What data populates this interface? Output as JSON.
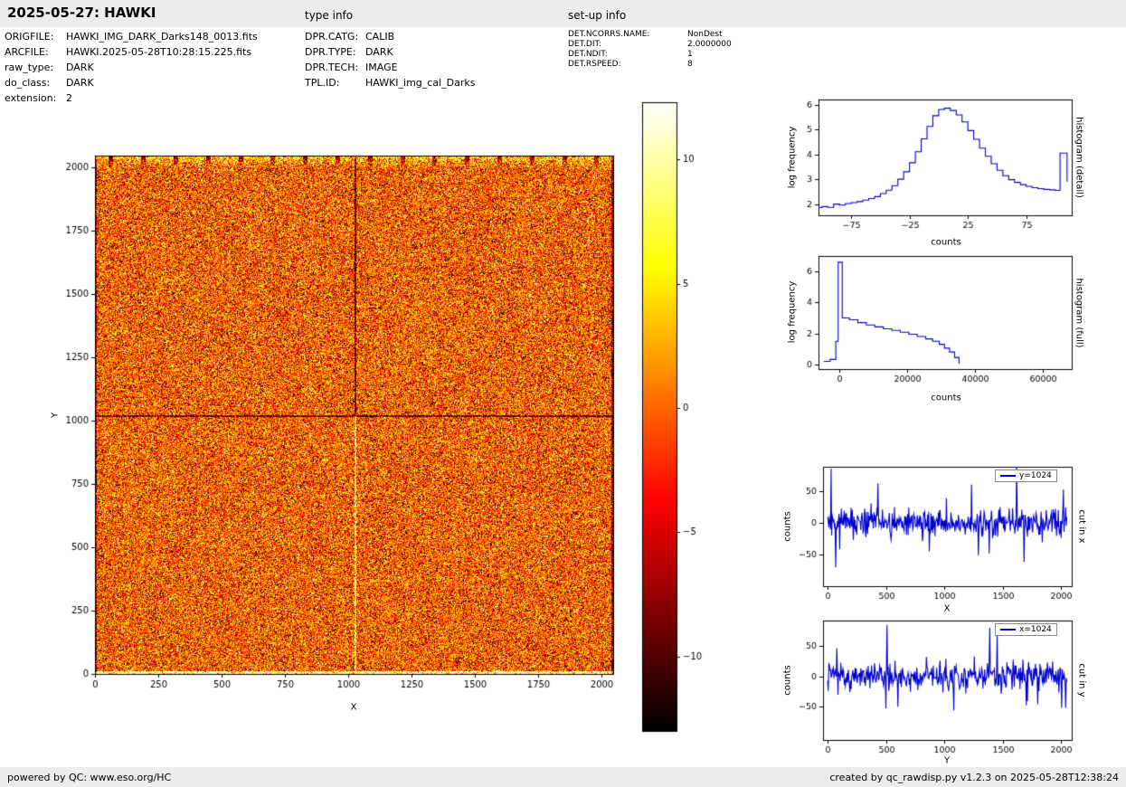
{
  "header": {
    "title": "2025-05-27: HAWKI",
    "type_info_label": "type info",
    "setup_info_label": "set-up info"
  },
  "metadata": {
    "left": [
      {
        "label": "ORIGFILE:",
        "value": "HAWKI_IMG_DARK_Darks148_0013.fits"
      },
      {
        "label": "ARCFILE:",
        "value": "HAWKI.2025-05-28T10:28:15.225.fits"
      },
      {
        "label": "raw_type:",
        "value": "DARK"
      },
      {
        "label": "do_class:",
        "value": "DARK"
      },
      {
        "label": "extension:",
        "value": "2"
      }
    ],
    "type_info": [
      {
        "label": "DPR.CATG:",
        "value": "CALIB"
      },
      {
        "label": "DPR.TYPE:",
        "value": "DARK"
      },
      {
        "label": "DPR.TECH:",
        "value": "IMAGE"
      },
      {
        "label": "TPL.ID:",
        "value": "HAWKI_img_cal_Darks"
      }
    ],
    "setup_info": [
      {
        "label": "DET.NCORRS.NAME:",
        "value": "NonDest"
      },
      {
        "label": "DET.DIT:",
        "value": "2.0000000"
      },
      {
        "label": "DET.NDIT:",
        "value": "1"
      },
      {
        "label": "DET.RSPEED:",
        "value": "8"
      }
    ]
  },
  "footer": {
    "left": "powered by QC: www.eso.org/HC",
    "right": "created by qc_rawdisp.py v1.2.3 on 2025-05-28T12:38:24"
  },
  "chart_data": [
    {
      "id": "main_image",
      "type": "heatmap",
      "xlabel": "X",
      "ylabel": "Y",
      "xlim": [
        0,
        2048
      ],
      "ylim": [
        0,
        2048
      ],
      "xticks": [
        0,
        250,
        500,
        750,
        1000,
        1250,
        1500,
        1750,
        2000
      ],
      "yticks": [
        0,
        250,
        500,
        750,
        1000,
        1250,
        1500,
        1750,
        2000
      ],
      "colormap": "hot",
      "value_range": [
        -13,
        12.3
      ],
      "crosshair_x": 1024,
      "crosshair_y": 1024,
      "noise_model": {
        "seed": 20250527,
        "dark_frac": 0.17,
        "bright_frac": 0.06,
        "mean": 0.53,
        "std": 0.12
      }
    },
    {
      "id": "colorbar",
      "type": "colorbar",
      "colormap": "hot",
      "vmin": -13,
      "vmax": 12.3,
      "ticks": [
        10,
        5,
        0,
        -5,
        -10
      ]
    },
    {
      "id": "hist_detail",
      "type": "line",
      "step": true,
      "right_label": "histogram (detail)",
      "xlabel": "counts",
      "ylabel": "log frequency",
      "line_color": "#0000cd",
      "xlim": [
        -103,
        114
      ],
      "ylim": [
        1.55,
        6.2
      ],
      "xticks": [
        -75,
        -25,
        25,
        75
      ],
      "yticks": [
        2,
        3,
        4,
        5,
        6
      ],
      "x": [
        -103,
        -100,
        -95,
        -90,
        -85,
        -80,
        -75,
        -70,
        -65,
        -60,
        -55,
        -50,
        -45,
        -40,
        -35,
        -30,
        -25,
        -20,
        -15,
        -10,
        -5,
        0,
        5,
        10,
        15,
        20,
        25,
        30,
        35,
        40,
        45,
        50,
        55,
        60,
        65,
        70,
        75,
        80,
        85,
        90,
        95,
        100,
        104,
        110
      ],
      "y": [
        1.86,
        1.9,
        1.87,
        2.0,
        1.96,
        2.02,
        2.06,
        2.1,
        2.16,
        2.22,
        2.3,
        2.42,
        2.56,
        2.74,
        3.0,
        3.3,
        3.66,
        4.1,
        4.62,
        5.12,
        5.55,
        5.8,
        5.85,
        5.76,
        5.58,
        5.3,
        4.95,
        4.6,
        4.25,
        3.92,
        3.62,
        3.36,
        3.14,
        2.98,
        2.87,
        2.78,
        2.71,
        2.66,
        2.62,
        2.59,
        2.57,
        2.55,
        4.05,
        2.9
      ]
    },
    {
      "id": "hist_full",
      "type": "line",
      "step": true,
      "right_label": "histogram (full)",
      "xlabel": "counts",
      "ylabel": "log frequency",
      "line_color": "#0000cd",
      "xlim": [
        -6100,
        68500
      ],
      "ylim": [
        -0.3,
        7
      ],
      "xticks": [
        0,
        20000,
        40000,
        60000
      ],
      "yticks": [
        0,
        2,
        4,
        6
      ],
      "x": [
        -4600,
        -2700,
        -1000,
        -300,
        900,
        3000,
        5500,
        8000,
        10500,
        13000,
        15500,
        18000,
        20500,
        23000,
        25500,
        27500,
        29500,
        31000,
        32500,
        34000,
        35300
      ],
      "y": [
        0.2,
        0.32,
        1.5,
        6.6,
        3.0,
        2.88,
        2.7,
        2.55,
        2.42,
        2.3,
        2.2,
        2.08,
        1.95,
        1.8,
        1.65,
        1.5,
        1.3,
        1.05,
        0.8,
        0.45,
        0.05
      ]
    },
    {
      "id": "cut_x",
      "type": "line",
      "legend": "y=1024",
      "right_label": "cut in x",
      "xlabel": "X",
      "ylabel": "counts",
      "line_color": "#0000cd",
      "xlim": [
        -40,
        2090
      ],
      "ylim": [
        -100,
        88
      ],
      "xticks": [
        0,
        500,
        1000,
        1500,
        2000
      ],
      "yticks": [
        -50,
        0,
        50
      ],
      "noise_model": {
        "seed": 777,
        "n": 420,
        "x_max": 2048,
        "std": 11,
        "outlier_prob": 0.05,
        "outlier_scale": 2.4
      },
      "spikes": [
        [
          30,
          85
        ],
        [
          105,
          -42
        ],
        [
          430,
          62
        ],
        [
          870,
          -45
        ],
        [
          1230,
          60
        ],
        [
          1620,
          88
        ],
        [
          1680,
          -62
        ],
        [
          2020,
          52
        ]
      ]
    },
    {
      "id": "cut_y",
      "type": "line",
      "legend": "x=1024",
      "right_label": "cut in y",
      "xlabel": "Y",
      "ylabel": "counts",
      "line_color": "#0000cd",
      "xlim": [
        -40,
        2090
      ],
      "ylim": [
        -105,
        92
      ],
      "xticks": [
        0,
        500,
        1000,
        1500,
        2000
      ],
      "yticks": [
        -50,
        0,
        50
      ],
      "noise_model": {
        "seed": 1234,
        "n": 420,
        "x_max": 2048,
        "std": 11,
        "outlier_prob": 0.05,
        "outlier_scale": 2.4
      },
      "spikes": [
        [
          80,
          46
        ],
        [
          510,
          85
        ],
        [
          600,
          -50
        ],
        [
          1080,
          -56
        ],
        [
          1390,
          80
        ],
        [
          1450,
          70
        ],
        [
          1700,
          -48
        ],
        [
          2040,
          -52
        ]
      ]
    }
  ]
}
